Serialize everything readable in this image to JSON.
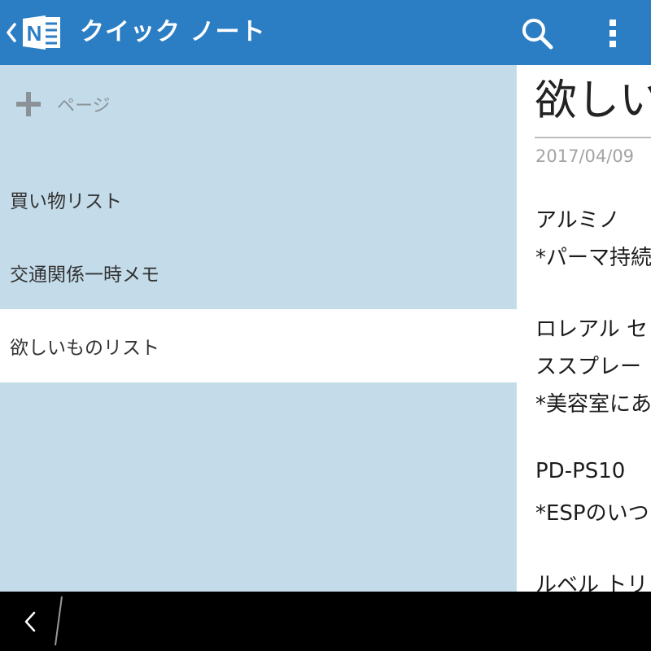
{
  "header": {
    "title": "クイック ノート",
    "logo_letter": "N"
  },
  "sidebar": {
    "add_page_label": "ページ",
    "items": [
      {
        "label": "買い物リスト",
        "selected": false
      },
      {
        "label": "交通関係一時メモ",
        "selected": false
      },
      {
        "label": "欲しいものリスト",
        "selected": true
      }
    ]
  },
  "note": {
    "title": "欲しい",
    "date": "2017/04/09",
    "lines": [
      "アルミノ",
      "*パーマ持続",
      "ロレアル セ",
      "ススプレー",
      "*美容室にあ",
      "PD-PS10",
      "*ESPのいつ",
      "ルベル トリ"
    ]
  },
  "colors": {
    "header_bg": "#2b7ec4",
    "sidebar_bg": "#c4dcea",
    "selected_bg": "#ffffff",
    "navbar_bg": "#000000"
  }
}
